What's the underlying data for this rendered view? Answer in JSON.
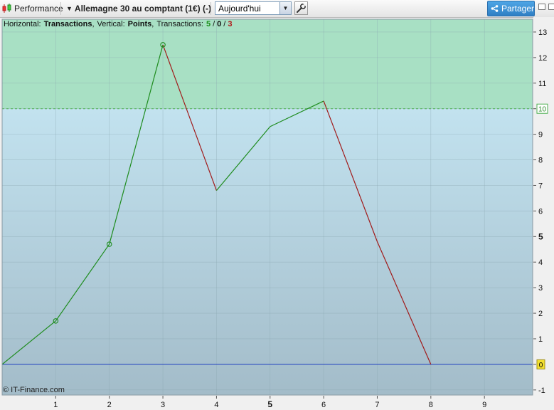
{
  "toolbar": {
    "module_label": "Performance",
    "instrument": "Allemagne 30 au comptant (1€) (-)",
    "period": "Aujourd'hui",
    "share_label": "Partager"
  },
  "header": {
    "horizontal_label": "Horizontal:",
    "horizontal_value": "Transactions",
    "vertical_label": "Vertical:",
    "vertical_value": "Points",
    "transactions_label": "Transactions:",
    "transactions_win": "5",
    "transactions_sep1": "/",
    "transactions_neutral": "0",
    "transactions_sep2": "/",
    "transactions_loss": "3",
    "win_color": "#1a8f1a",
    "loss_color": "#b01818"
  },
  "copyright": "© IT-Finance.com",
  "chart_data": {
    "type": "line",
    "x": [
      0,
      1,
      2,
      3,
      4,
      5,
      6,
      7,
      8
    ],
    "y": [
      0,
      1.7,
      4.7,
      12.5,
      6.8,
      9.3,
      10.3,
      4.8,
      0
    ],
    "segment_colors": [
      "green",
      "green",
      "green",
      "red",
      "green",
      "green",
      "red",
      "red"
    ],
    "markers_at": [
      1,
      2,
      3
    ],
    "xlim": [
      0,
      9.9
    ],
    "ylim": [
      -1.2,
      13.5
    ],
    "x_ticks": [
      "1",
      "2",
      "3",
      "4",
      "5",
      "6",
      "7",
      "8",
      "9"
    ],
    "y_ticks": [
      "-1",
      "0",
      "1",
      "2",
      "3",
      "4",
      "5",
      "6",
      "7",
      "8",
      "9",
      "10",
      "11",
      "12",
      "13"
    ],
    "threshold": 10,
    "threshold_label": "10",
    "zero_label": "0",
    "colors": {
      "up": "#1e8c1e",
      "down": "#a11a1a",
      "zero_line": "#2040c0",
      "zone_above": "#a8e0c4",
      "zone_below_top": "#c2e2ef",
      "zone_below_bottom": "#a3bcc9",
      "grid": "#8aa6b0",
      "threshold_tag": "#4caf50",
      "zero_tag": "#f2df30"
    },
    "grid": true
  }
}
